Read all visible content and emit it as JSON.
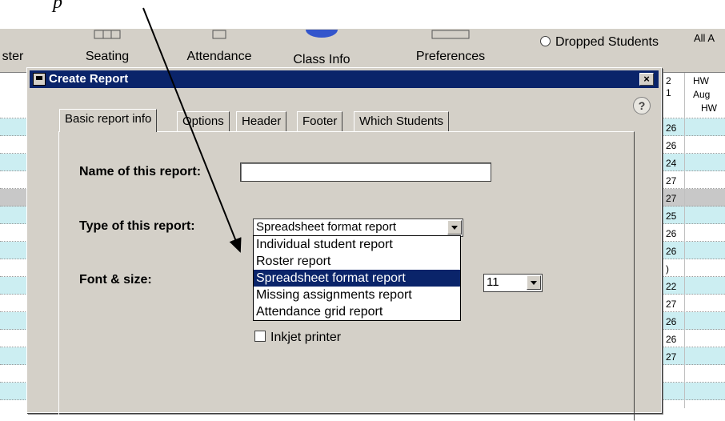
{
  "annotation": {
    "text": "p"
  },
  "toolbar": {
    "items": [
      {
        "label": "ster"
      },
      {
        "label": "Seating"
      },
      {
        "label": "Attendance"
      },
      {
        "label": "Class Info"
      },
      {
        "label": "Preferences"
      }
    ],
    "dropped_students_label": "Dropped Students",
    "all_label": "All A"
  },
  "background_grid": {
    "right_numbers": [
      "2",
      "1",
      "26",
      "26",
      "24",
      "27",
      "27",
      "25",
      "26",
      "26",
      ")",
      "22",
      "27",
      "26",
      "26",
      "27"
    ],
    "hw_header": [
      "HW",
      "Aug",
      "HW"
    ]
  },
  "dialog": {
    "title": "Create Report",
    "close_label": "×",
    "help_label": "?",
    "tabs": [
      {
        "label": "Basic report info"
      },
      {
        "label": "Options"
      },
      {
        "label": "Header"
      },
      {
        "label": "Footer"
      },
      {
        "label": "Which Students"
      }
    ],
    "name_label": "Name of this report:",
    "name_value": "",
    "type_label": "Type of this report:",
    "type_selected": "Spreadsheet format report",
    "type_options": [
      "Individual student report",
      "Roster report",
      "Spreadsheet format report",
      "Missing assignments report",
      "Attendance grid report"
    ],
    "font_label": "Font & size:",
    "font_size": "11",
    "inkjet_label": "Inkjet printer"
  },
  "colors": {
    "title_bar": "#0a246a",
    "dialog_bg": "#d4d0c8",
    "row_highlight": "#cceef2",
    "selection": "#0a246a"
  }
}
